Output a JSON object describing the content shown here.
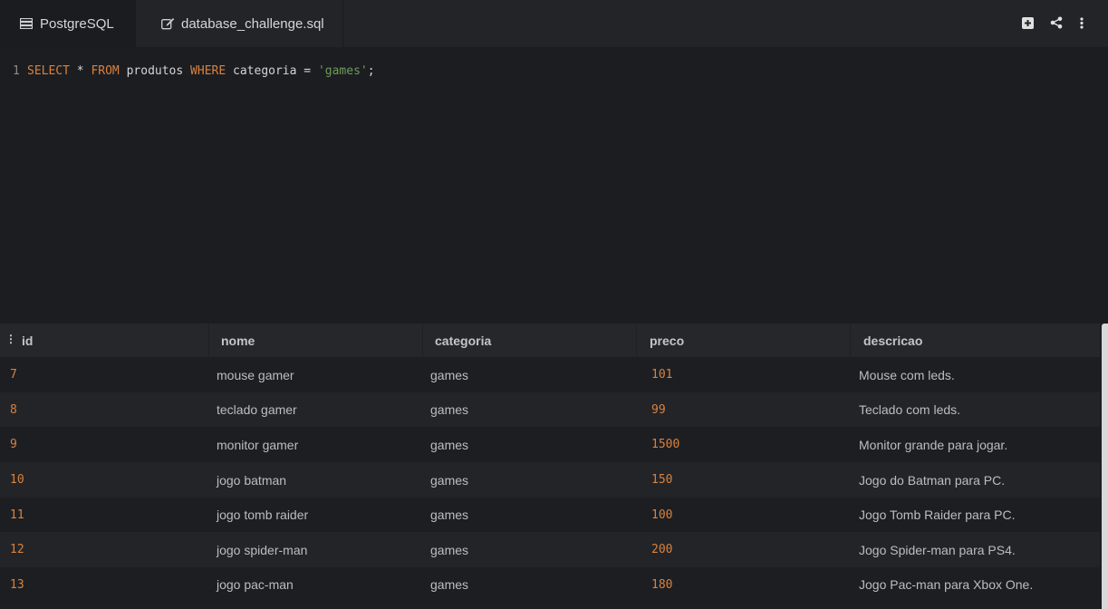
{
  "tabs": {
    "db_label": "PostgreSQL",
    "file_label": "database_challenge.sql"
  },
  "toolbar": {
    "icons": [
      "plus-square-icon",
      "share-icon",
      "more-vertical-icon"
    ]
  },
  "editor": {
    "line_number": "1",
    "tokens": {
      "select": "SELECT",
      "star": " * ",
      "from": "FROM",
      "table": " produtos ",
      "where": "WHERE",
      "condition": " categoria = ",
      "value": "'games'",
      "semicolon": ";"
    }
  },
  "results": {
    "columns": [
      "id",
      "nome",
      "categoria",
      "preco",
      "descricao"
    ],
    "rows": [
      [
        "7",
        "mouse gamer",
        "games",
        "101",
        "Mouse com leds."
      ],
      [
        "8",
        "teclado gamer",
        "games",
        "99",
        "Teclado com leds."
      ],
      [
        "9",
        "monitor gamer",
        "games",
        "1500",
        "Monitor grande para jogar."
      ],
      [
        "10",
        "jogo batman",
        "games",
        "150",
        "Jogo do Batman para PC."
      ],
      [
        "11",
        "jogo tomb raider",
        "games",
        "100",
        "Jogo Tomb Raider para PC."
      ],
      [
        "12",
        "jogo spider-man",
        "games",
        "200",
        "Jogo Spider-man para PS4."
      ],
      [
        "13",
        "jogo pac-man",
        "games",
        "180",
        "Jogo Pac-man para Xbox One."
      ]
    ]
  },
  "colors": {
    "keyword": "#d9823d",
    "string": "#6f9b5a",
    "number": "#d9823d",
    "background": "#1c1d21"
  }
}
